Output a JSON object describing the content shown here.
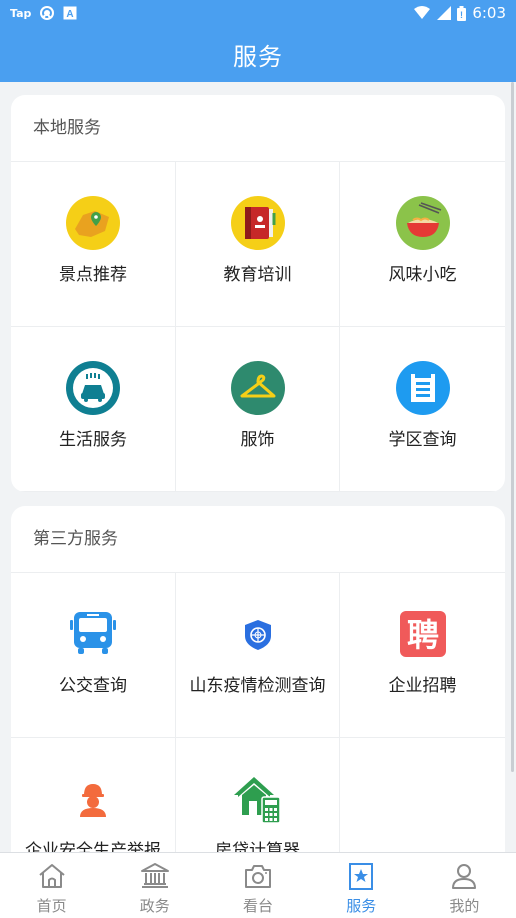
{
  "status_bar": {
    "app_badge": "Tap",
    "time": "6:03"
  },
  "header": {
    "title": "服务"
  },
  "sections": [
    {
      "title": "本地服务",
      "items": [
        {
          "label": "景点推荐",
          "icon": "map-pin-icon"
        },
        {
          "label": "教育培训",
          "icon": "book-icon"
        },
        {
          "label": "风味小吃",
          "icon": "noodle-bowl-icon"
        },
        {
          "label": "生活服务",
          "icon": "car-wash-icon"
        },
        {
          "label": "服饰",
          "icon": "hanger-icon"
        },
        {
          "label": "学区查询",
          "icon": "document-icon"
        }
      ]
    },
    {
      "title": "第三方服务",
      "items": [
        {
          "label": "公交查询",
          "icon": "bus-icon"
        },
        {
          "label": "山东疫情检测查询",
          "icon": "shield-icon"
        },
        {
          "label": "企业招聘",
          "icon": "recruit-icon",
          "glyph": "聘"
        },
        {
          "label": "企业安全生产举报",
          "icon": "worker-helmet-icon"
        },
        {
          "label": "房贷计算器",
          "icon": "house-calculator-icon"
        }
      ]
    }
  ],
  "tabs": [
    {
      "label": "首页",
      "icon": "home-icon",
      "active": false
    },
    {
      "label": "政务",
      "icon": "government-building-icon",
      "active": false
    },
    {
      "label": "看台",
      "icon": "camera-icon",
      "active": false
    },
    {
      "label": "服务",
      "icon": "star-bookmark-icon",
      "active": true
    },
    {
      "label": "我的",
      "icon": "user-icon",
      "active": false
    }
  ],
  "colors": {
    "primary": "#4a9ff0",
    "active_tab": "#3a8ee6",
    "inactive_tab": "#8a8a8a"
  }
}
